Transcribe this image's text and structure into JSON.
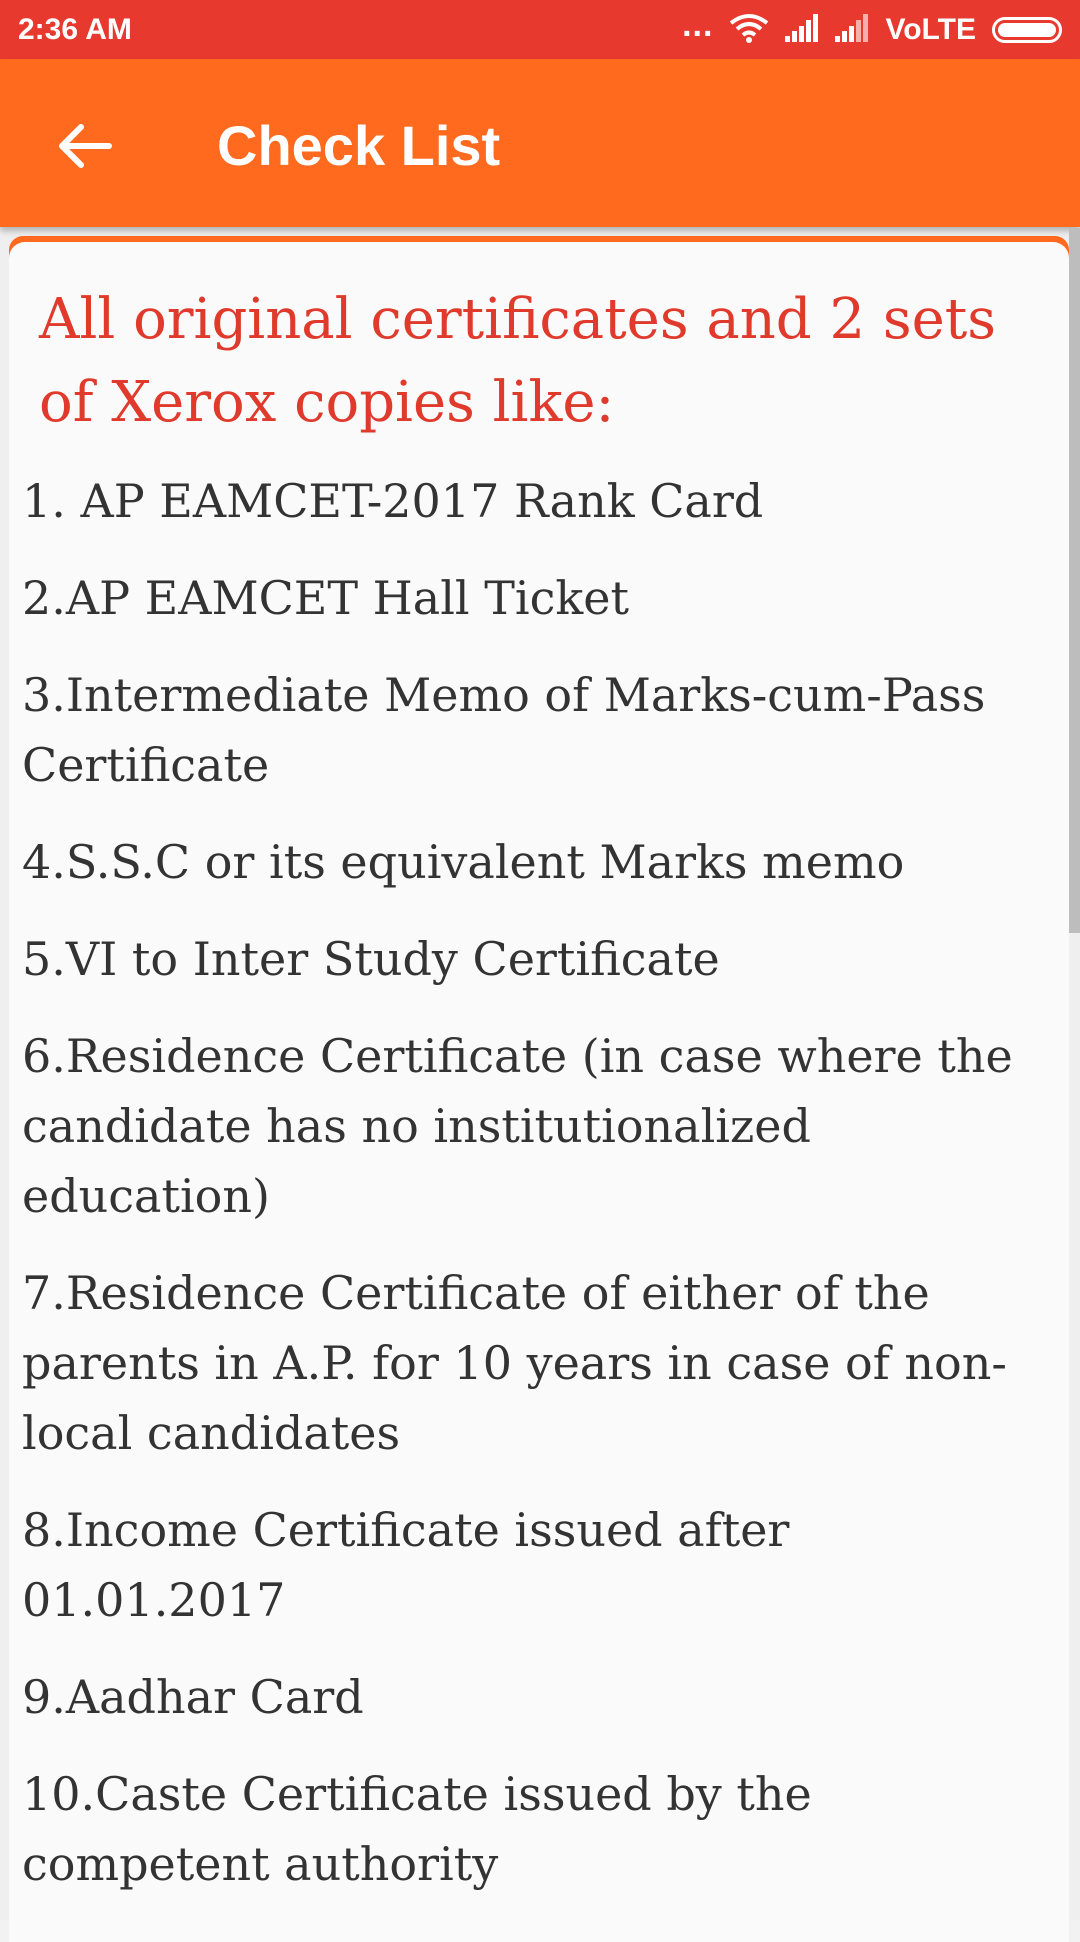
{
  "status_bar": {
    "time": "2:36 AM",
    "dots": "...",
    "network_label": "VoLTE"
  },
  "app_bar": {
    "title": "Check List",
    "back_icon": "arrow-left-icon"
  },
  "colors": {
    "status_bar": "#e8392f",
    "app_bar": "#ff6a1e",
    "heading_text": "#e03a2c",
    "body_text": "#333333",
    "card_background": "#fafafa"
  },
  "content": {
    "heading": "All original certificates and 2 sets of Xerox copies like:",
    "items": [
      "1. AP EAMCET-2017 Rank Card",
      "2.AP EAMCET Hall Ticket",
      "3.Intermediate Memo of Marks-cum-Pass Certificate",
      "4.S.S.C or its equivalent Marks memo",
      "5.VI to Inter Study Certificate",
      "6.Residence Certificate (in case where the candidate has no institutionalized education)",
      "7.Residence Certificate of either of the parents in A.P. for 10 years in case of non-local candidates",
      "8.Income Certificate issued after 01.01.2017",
      "9.Aadhar Card",
      "10.Caste Certificate issued by the competent authority"
    ]
  }
}
